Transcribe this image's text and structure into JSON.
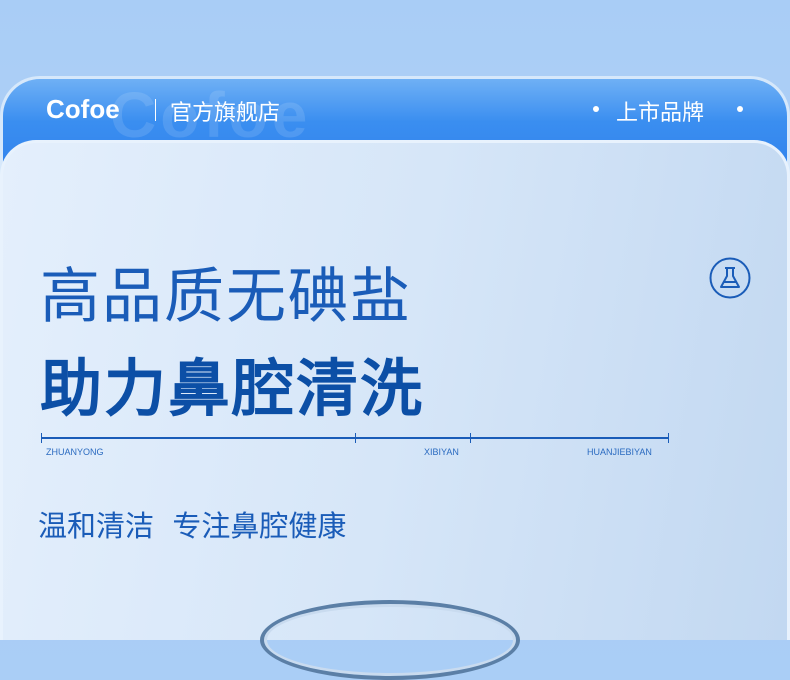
{
  "header": {
    "brand": "Cofoe",
    "store": "官方旗舰店",
    "listed": "上市品牌",
    "watermark": "Cofoe"
  },
  "headline": {
    "line1": "高品质无碘盐",
    "line2": "助力鼻腔清洗"
  },
  "timeline": {
    "labels": [
      "ZHUANYONG",
      "XIBIYAN",
      "HUANJIEBIYAN"
    ]
  },
  "subtitle": "温和清洁  专注鼻腔健康",
  "colors": {
    "accent": "#1a5cb8",
    "banner": "#2f80ec"
  }
}
